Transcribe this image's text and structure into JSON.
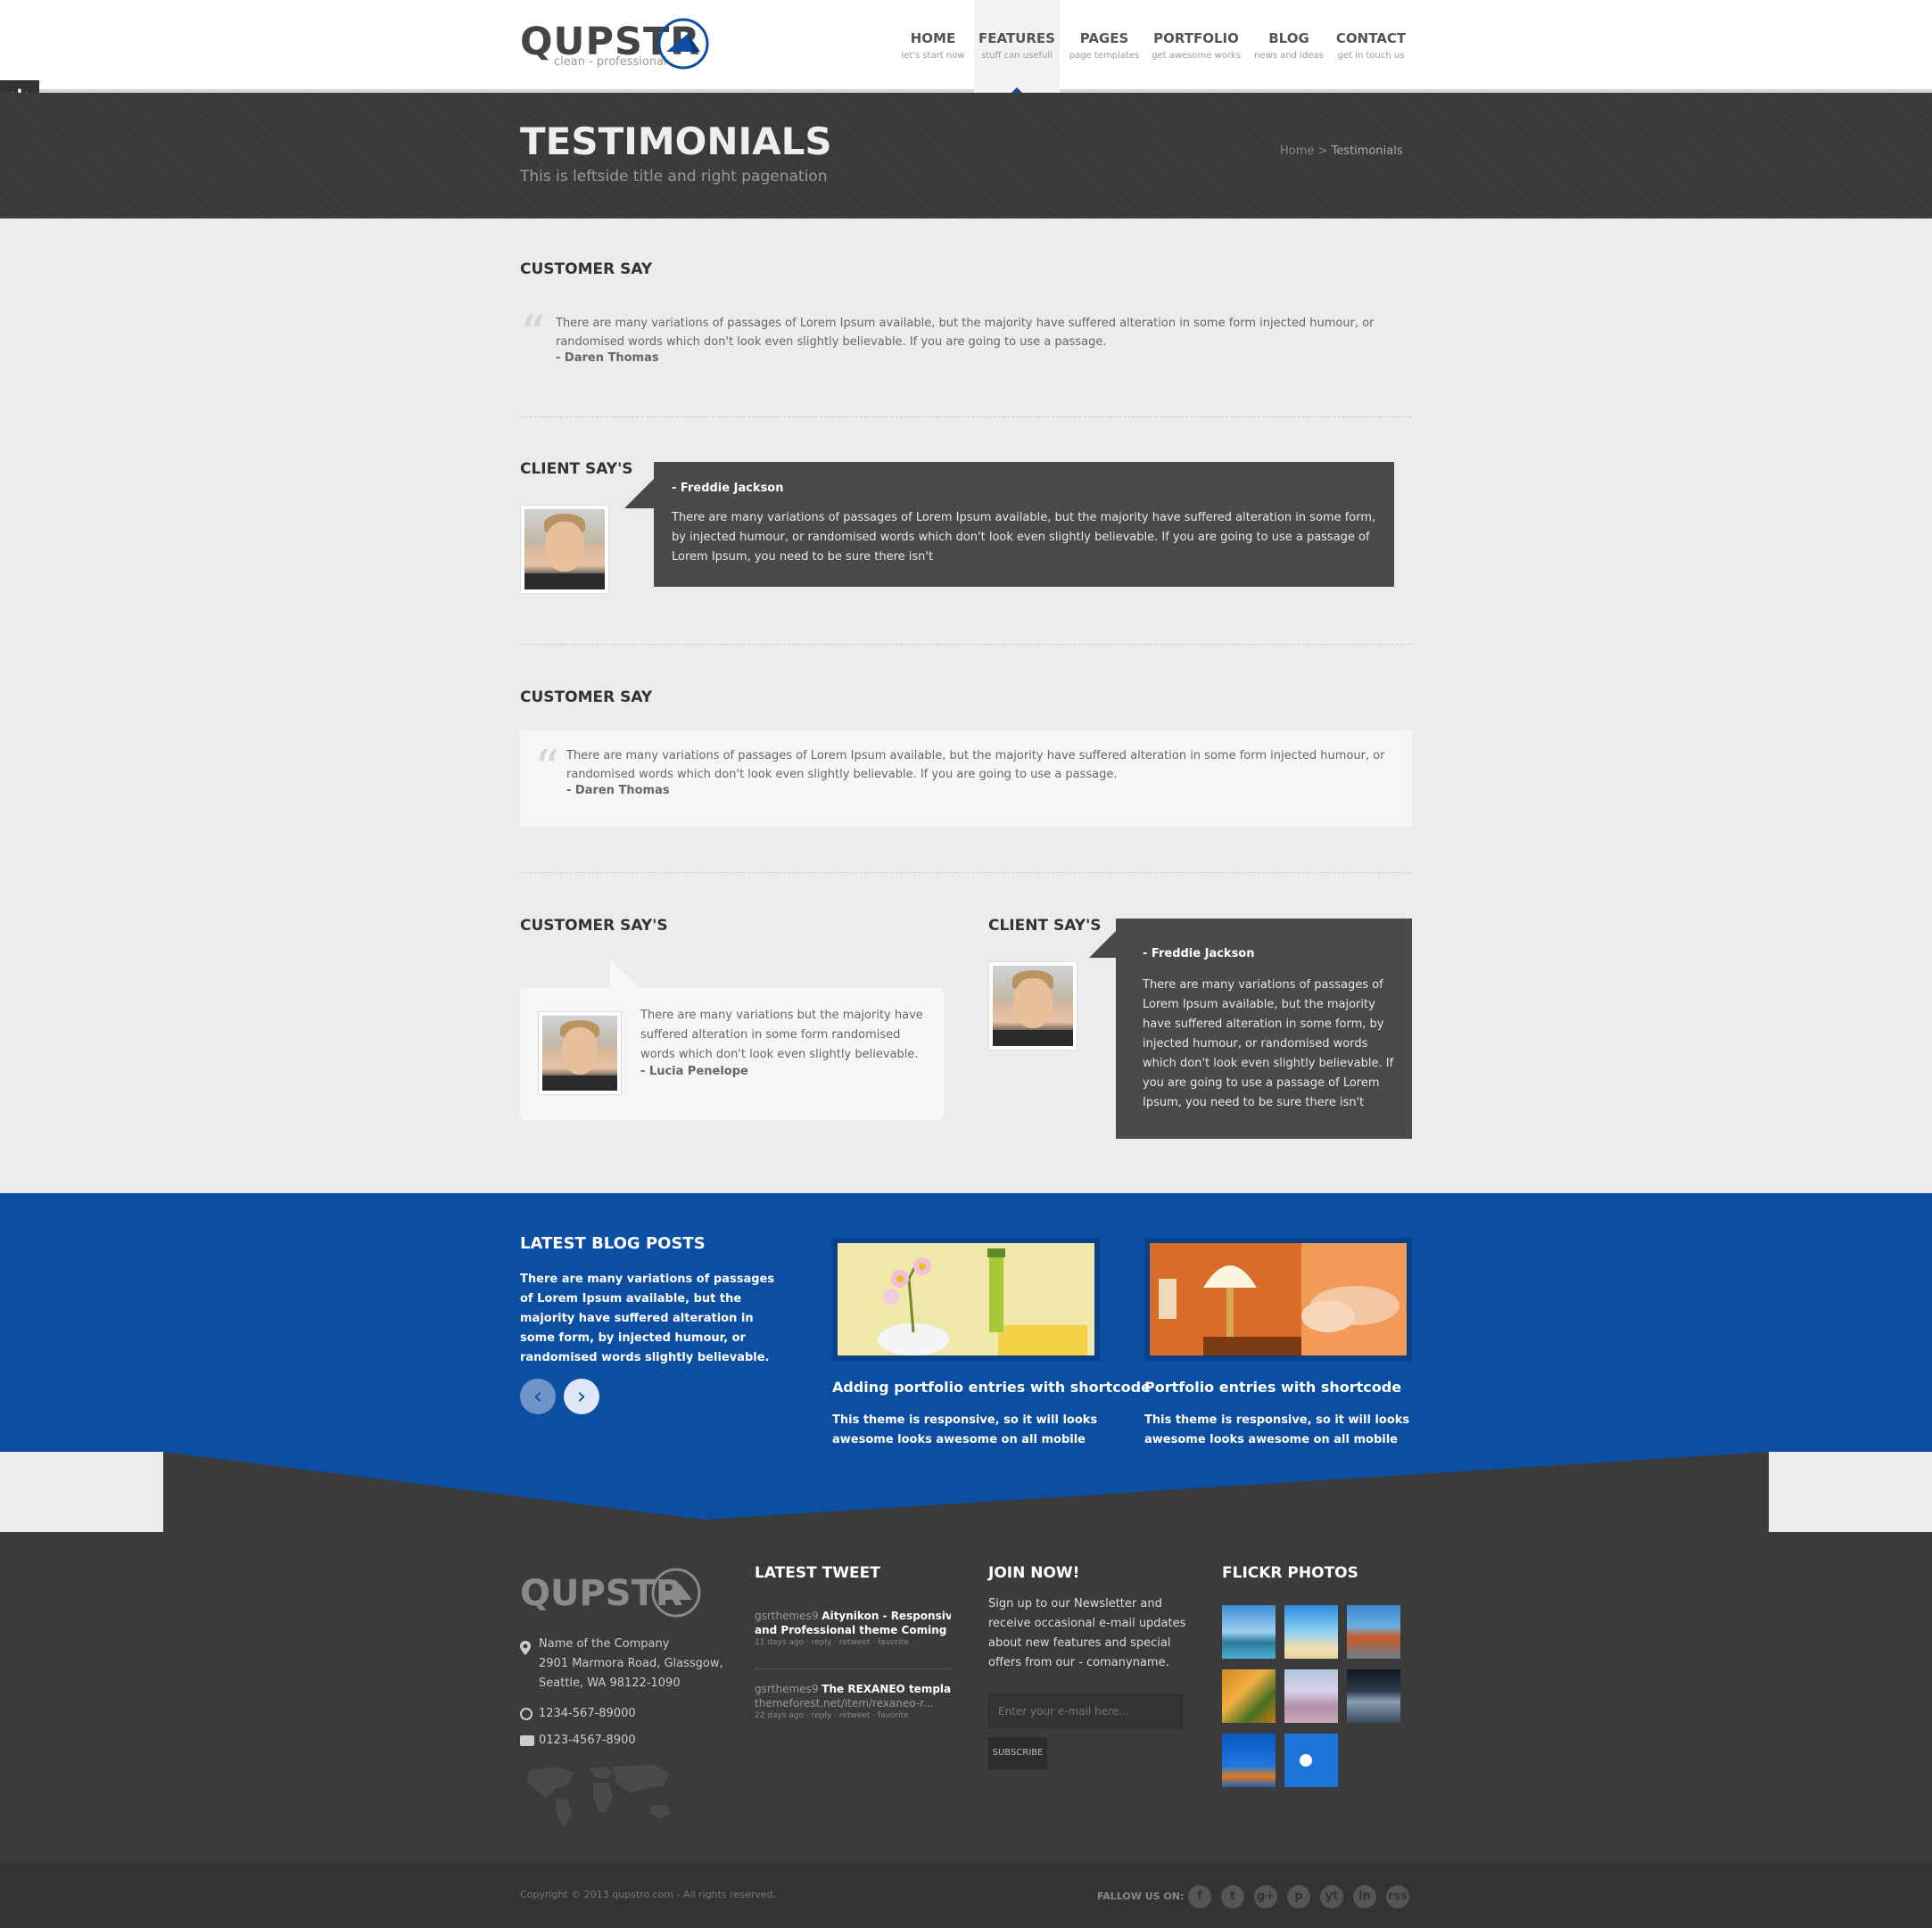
{
  "brand": {
    "name": "QUPSTR",
    "tagline": "clean - professional"
  },
  "nav": [
    {
      "label": "HOME",
      "sub": "let's start now"
    },
    {
      "label": "FEATURES",
      "sub": "stuff can usefull"
    },
    {
      "label": "PAGES",
      "sub": "page templates"
    },
    {
      "label": "PORTFOLIO",
      "sub": "get awesome works"
    },
    {
      "label": "BLOG",
      "sub": "news and ideas"
    },
    {
      "label": "CONTACT",
      "sub": "get in touch us"
    }
  ],
  "page": {
    "title": "TESTIMONIALS",
    "subtitle": "This is leftside title and right pagenation",
    "breadcrumb_home": "Home",
    "breadcrumb_sep": ">",
    "breadcrumb_current": "Testimonials"
  },
  "sections": {
    "s1": {
      "title": "CUSTOMER SAY",
      "text": "There are many variations of passages of Lorem Ipsum available, but the majority have suffered alteration in some form injected humour, or randomised words which don't look even slightly believable. If you are going to use a passage.",
      "author": "- Daren Thomas"
    },
    "s2": {
      "title": "CLIENT SAY'S",
      "author": "- Freddie Jackson",
      "text": "There are many variations of passages of Lorem Ipsum available, but the majority have suffered alteration in some form, by injected humour, or randomised words which don't look even slightly believable. If you are going to use a passage of Lorem Ipsum, you need to be sure there isn't"
    },
    "s3": {
      "title": "CUSTOMER SAY",
      "text": "There are many variations of passages of Lorem Ipsum available, but the majority have suffered alteration in some form injected humour, or randomised words which don't look even slightly believable. If you are going to use a passage.",
      "author": "- Daren Thomas"
    },
    "s4": {
      "title": "CUSTOMER SAY'S",
      "text": "There are many variations but the majority have suffered alteration in some form randomised words which don't look even slightly believable.",
      "author": "- Lucia Penelope"
    },
    "s5": {
      "title": "CLIENT SAY'S",
      "author": "- Freddie Jackson",
      "text": "There are many variations of passages of Lorem Ipsum available, but the majority have suffered alteration in some form, by injected humour, or randomised words which don't look even slightly believable. If you are going to use a passage of Lorem Ipsum, you need to be sure there isn't"
    }
  },
  "blog": {
    "title": "LATEST BLOG POSTS",
    "text": "There are many variations of passages of Lorem Ipsum available, but the majority have suffered alteration in some form, by injected humour, or randomised words slightly believable.",
    "prev": "‹",
    "next": "›",
    "posts": [
      {
        "title": "Adding portfolio entries with shortcode",
        "text": "This theme is responsive, so it will looks awesome looks awesome on all mobile devices."
      },
      {
        "title": "Portfolio entries with shortcode",
        "text": "This theme is responsive, so it will looks awesome looks awesome on all mobile devices."
      }
    ]
  },
  "footer": {
    "company": "Name of the Company",
    "address1": "2901 Marmora Road, Glassgow,",
    "address2": "Seattle, WA 98122-1090",
    "phone": "1234-567-89000",
    "fax": "0123-4567-8900",
    "tweet_title": "LATEST TWEET",
    "tweets": [
      {
        "user": "gsrthemes9",
        "text1": "Aitynikon - Responsive HT",
        "text2": "and Professional theme Coming soon.",
        "meta": "11 days ago · reply · retweet · favorite"
      },
      {
        "user": "gsrthemes9",
        "text1": "The REXANEO template o",
        "text2": "themeforest.net/item/rexaneo-r...",
        "meta": "22 days ago · reply · retweet · favorite"
      }
    ],
    "join_title": "JOIN NOW!",
    "join_text": "Sign up to our Newsletter and receive occasional e-mail updates about new features and special offers from our - comanyname.",
    "email_placeholder": "Enter your e-mail here...",
    "subscribe": "SUBSCRIBE",
    "flickr_title": "FLICKR PHOTOS",
    "copyright": "Copyright © 2013 qupstro.com - All rights reserved.",
    "follow": "FALLOW US ON:",
    "social": [
      "f",
      "t",
      "g+",
      "p",
      "yt",
      "in",
      "rss"
    ]
  }
}
